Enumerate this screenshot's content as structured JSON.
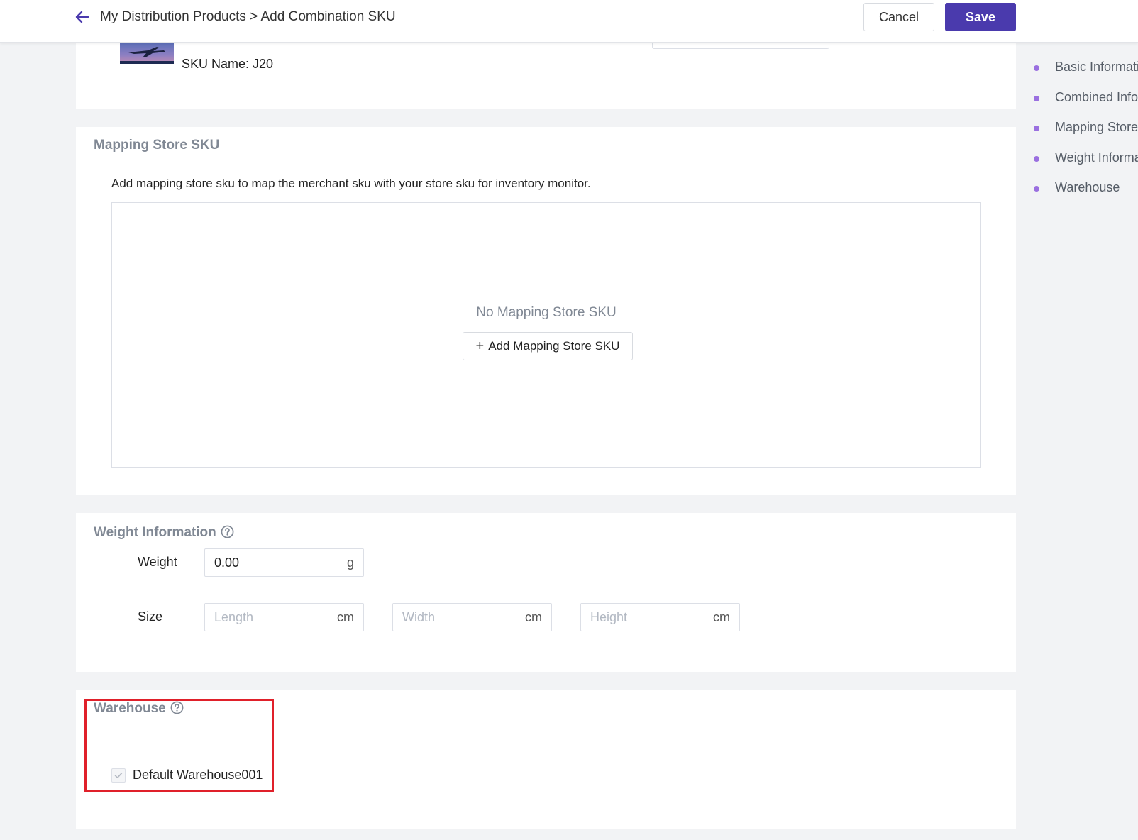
{
  "header": {
    "breadcrumb": "My Distribution Products > Add Combination SKU",
    "cancel_label": "Cancel",
    "save_label": "Save",
    "accent_color": "#4a3aad"
  },
  "basic": {
    "sku_name": "SKU Name: J20"
  },
  "mapping": {
    "title": "Mapping Store SKU",
    "description": "Add mapping store sku to map the merchant sku with your store sku for inventory monitor.",
    "empty_text": "No Mapping Store SKU",
    "add_button_label": "Add Mapping Store SKU"
  },
  "weight": {
    "title": "Weight Information",
    "weight_label": "Weight",
    "weight_value": "0.00",
    "weight_unit": "g",
    "size_label": "Size",
    "length_placeholder": "Length",
    "width_placeholder": "Width",
    "height_placeholder": "Height",
    "size_unit": "cm"
  },
  "warehouse": {
    "title": "Warehouse",
    "default_warehouse": "Default Warehouse001",
    "checked": true,
    "highlight_color": "#e0202a"
  },
  "anchors": [
    {
      "label": "Basic Informatio"
    },
    {
      "label": "Combined Inforr"
    },
    {
      "label": "Mapping Store S"
    },
    {
      "label": "Weight Informat"
    },
    {
      "label": "Warehouse"
    }
  ]
}
